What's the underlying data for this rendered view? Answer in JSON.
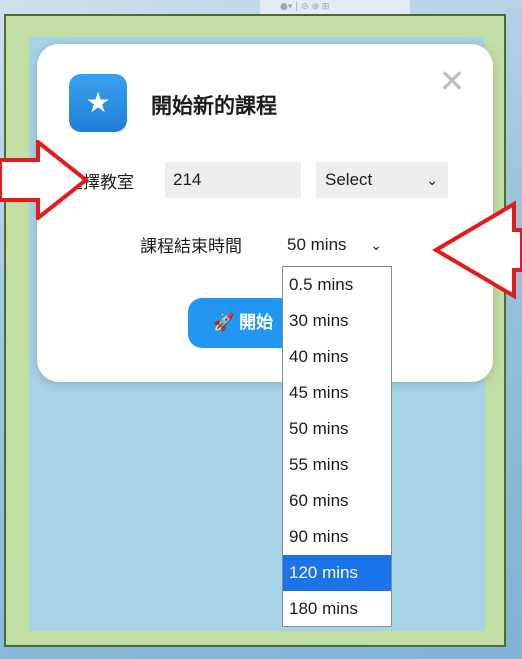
{
  "dialog": {
    "title": "開始新的課程",
    "close_label": "✕",
    "classroom_label": "選擇教室",
    "classroom_value": "214",
    "room_select_value": "Select",
    "endtime_label": "課程結束時間",
    "endtime_value": "50 mins",
    "start_button_label": "開始"
  },
  "dropdown": {
    "options": [
      "0.5 mins",
      "30 mins",
      "40 mins",
      "45 mins",
      "50 mins",
      "55 mins",
      "60 mins",
      "90 mins",
      "120 mins",
      "180 mins"
    ],
    "highlighted": "120 mins"
  },
  "colors": {
    "accent": "#2196f3",
    "arrow": "#e31b1b",
    "frame": "#c3dea4"
  }
}
